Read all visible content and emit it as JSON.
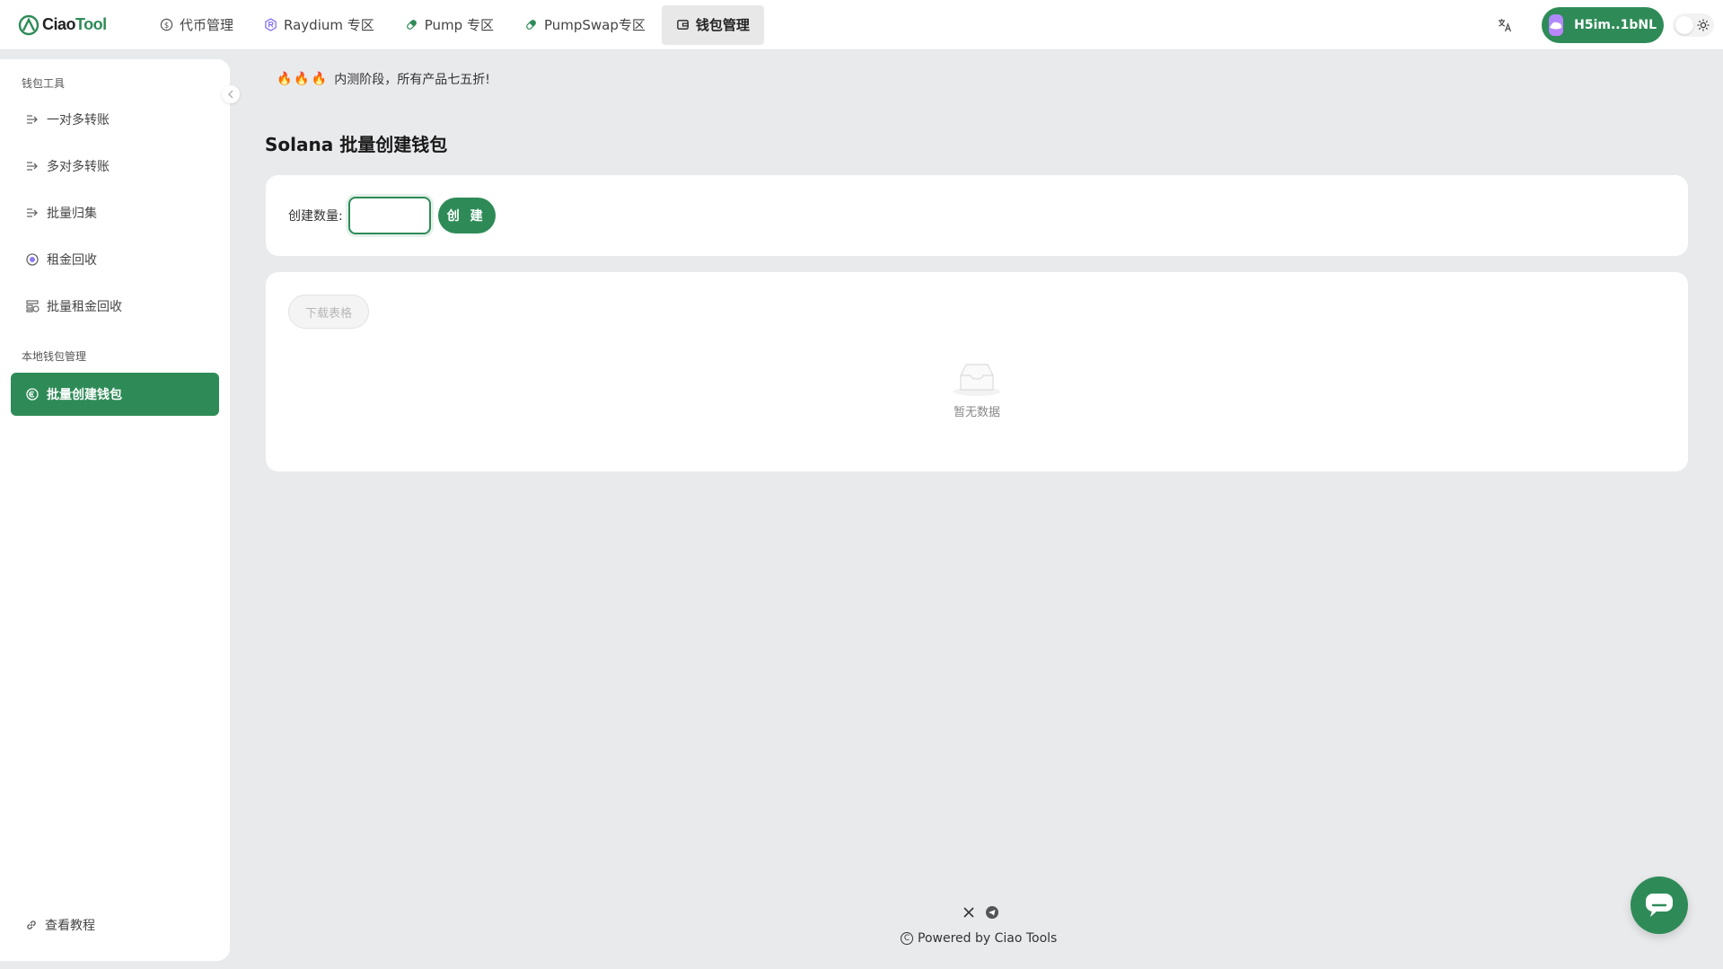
{
  "brand": {
    "logo_prefix": "Ciao",
    "logo_suffix": "Tool"
  },
  "nav": {
    "items": [
      {
        "label": "代币管理",
        "icon": "dollar-circle-icon"
      },
      {
        "label": "Raydium 专区",
        "icon": "raydium-icon"
      },
      {
        "label": "Pump 专区",
        "icon": "pill-icon"
      },
      {
        "label": "PumpSwap专区",
        "icon": "pill-icon"
      },
      {
        "label": "钱包管理",
        "icon": "wallet-icon",
        "active": true
      }
    ]
  },
  "header": {
    "wallet_label": "H5im..1bNL"
  },
  "sidebar": {
    "section1": "钱包工具",
    "items": [
      {
        "label": "一对多转账",
        "icon": "transfer-icon"
      },
      {
        "label": "多对多转账",
        "icon": "transfer-icon"
      },
      {
        "label": "批量归集",
        "icon": "collect-icon"
      },
      {
        "label": "租金回收",
        "icon": "coin-icon"
      },
      {
        "label": "批量租金回收",
        "icon": "batch-coin-icon"
      }
    ],
    "section2": "本地钱包管理",
    "active_item": "批量创建钱包",
    "tutorial": "查看教程"
  },
  "notice": {
    "fires": "🔥🔥🔥",
    "text": "内测阶段，所有产品七五折!"
  },
  "main": {
    "title": "Solana 批量创建钱包",
    "qty_label": "创建数量:",
    "qty_value": "",
    "create_button": "创 建",
    "download_button": "下载表格",
    "empty_text": "暂无数据"
  },
  "footer": {
    "powered": "Powered by Ciao Tools"
  },
  "colors": {
    "accent": "#2e8b57",
    "background": "#e9eaec",
    "card": "#ffffff"
  }
}
